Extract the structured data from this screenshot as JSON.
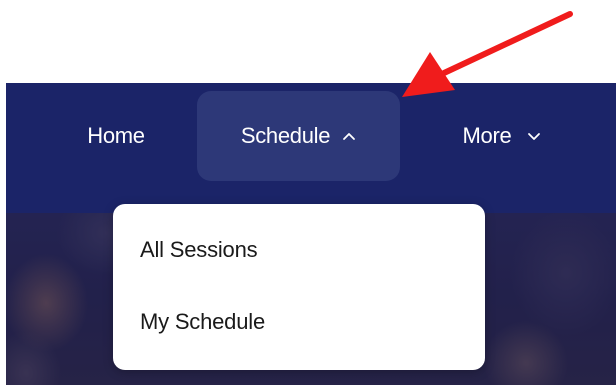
{
  "nav": {
    "items": [
      {
        "label": "Home",
        "state": "default"
      },
      {
        "label": "Schedule",
        "state": "expanded",
        "icon": "chevron-up-icon"
      },
      {
        "label": "More",
        "state": "collapsed",
        "icon": "chevron-down-icon"
      }
    ]
  },
  "dropdown": {
    "items": [
      {
        "label": "All Sessions"
      },
      {
        "label": "My Schedule"
      }
    ]
  },
  "annotation": {
    "type": "arrow",
    "color": "#f01c1c"
  },
  "colors": {
    "navbar": "#1b2468",
    "active_tab": "#2d3878",
    "text_on_nav": "#ffffff",
    "dropdown_bg": "#ffffff"
  }
}
